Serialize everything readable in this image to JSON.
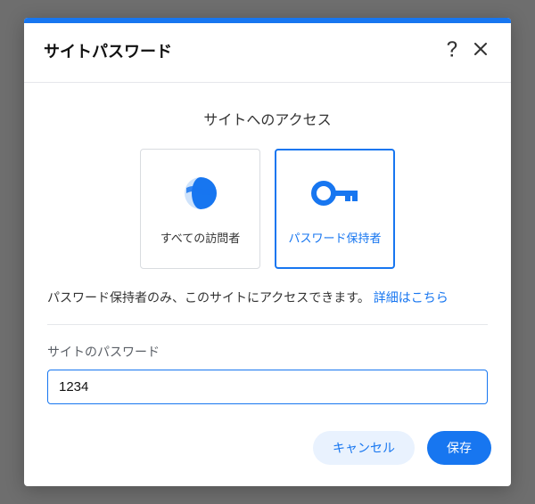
{
  "dialog": {
    "title": "サイトパスワード"
  },
  "section": {
    "heading": "サイトへのアクセス"
  },
  "options": {
    "all_visitors": "すべての訪問者",
    "password_holders": "パスワード保持者"
  },
  "help": {
    "text": "パスワード保持者のみ、このサイトにアクセスできます。",
    "link": "詳細はこちら"
  },
  "field": {
    "label": "サイトのパスワード",
    "value": "1234"
  },
  "buttons": {
    "cancel": "キャンセル",
    "save": "保存"
  }
}
